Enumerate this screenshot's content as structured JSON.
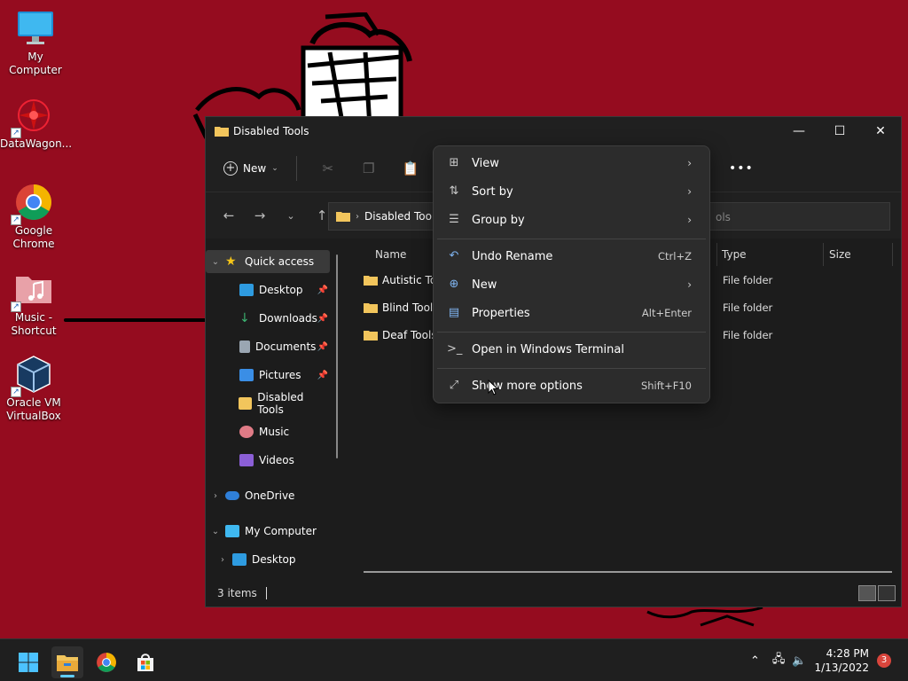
{
  "desktop": {
    "icons": [
      {
        "label": "My Computer"
      },
      {
        "label": "DataWagon..."
      },
      {
        "label": "Google Chrome"
      },
      {
        "label": "Music - Shortcut"
      },
      {
        "label": "Oracle VM VirtualBox"
      }
    ]
  },
  "window": {
    "title": "Disabled Tools",
    "controls": {
      "minimize": "—",
      "maximize": "☐",
      "close": "✕"
    }
  },
  "command_bar": {
    "new_label": "New",
    "more_label": "•••"
  },
  "address": {
    "path": "Disabled Tools",
    "search_placeholder": "ols"
  },
  "sidebar": {
    "items": [
      {
        "label": "Quick access"
      },
      {
        "label": "Desktop"
      },
      {
        "label": "Downloads"
      },
      {
        "label": "Documents"
      },
      {
        "label": "Pictures"
      },
      {
        "label": "Disabled Tools"
      },
      {
        "label": "Music"
      },
      {
        "label": "Videos"
      },
      {
        "label": "OneDrive"
      },
      {
        "label": "My Computer"
      },
      {
        "label": "Desktop"
      }
    ]
  },
  "columns": {
    "name": "Name",
    "type": "Type",
    "size": "Size"
  },
  "files": [
    {
      "name": "Autistic Too",
      "type": "File folder"
    },
    {
      "name": "Blind Tools",
      "type": "File folder"
    },
    {
      "name": "Deaf Tools",
      "type": "File folder"
    }
  ],
  "status": {
    "items_count": "3 items"
  },
  "context_menu": {
    "items": [
      {
        "label": "View",
        "icon": "view-icon"
      },
      {
        "label": "Sort by",
        "icon": "sort-icon"
      },
      {
        "label": "Group by",
        "icon": "group-icon"
      },
      {
        "label": "Undo Rename",
        "accel": "Ctrl+Z",
        "icon": "undo-icon"
      },
      {
        "label": "New",
        "icon": "new-icon"
      },
      {
        "label": "Properties",
        "accel": "Alt+Enter",
        "icon": "properties-icon"
      },
      {
        "label": "Open in Windows Terminal",
        "icon": "terminal-icon"
      },
      {
        "label": "Show more options",
        "accel": "Shift+F10",
        "icon": "more-options-icon"
      }
    ]
  },
  "taskbar": {
    "time": "4:28 PM",
    "date": "1/13/2022",
    "notification_count": "3"
  }
}
